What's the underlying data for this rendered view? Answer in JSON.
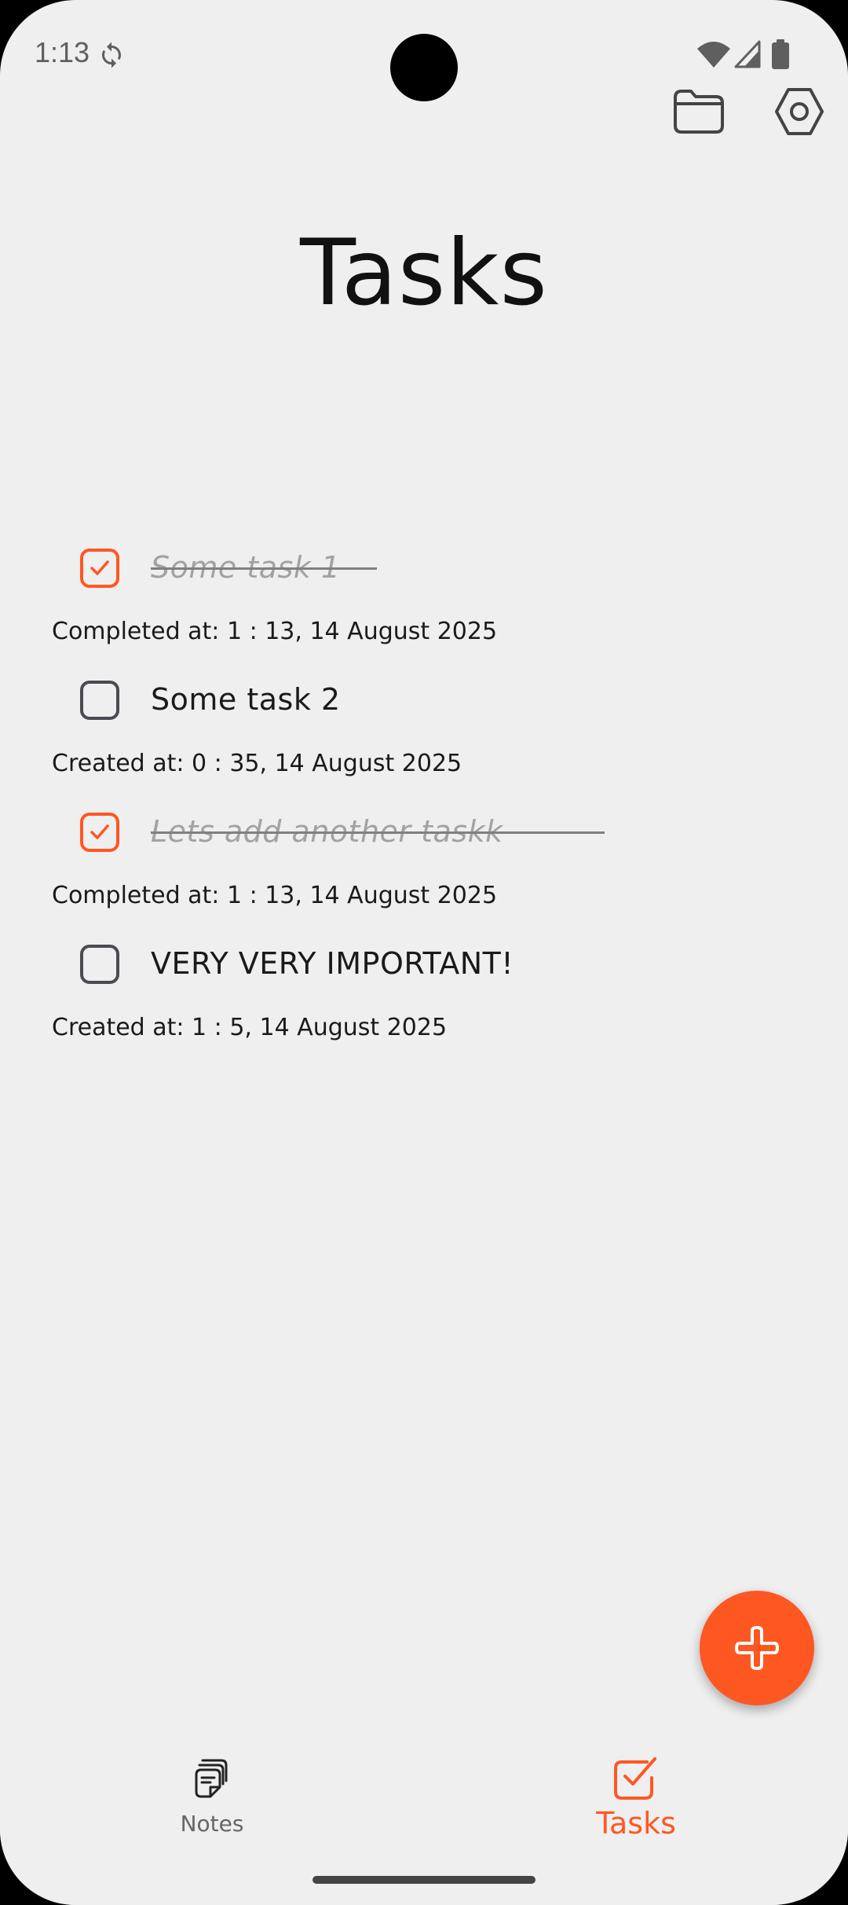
{
  "status_bar": {
    "time": "1:13"
  },
  "page": {
    "title": "Tasks"
  },
  "tasks": [
    {
      "title": "Some task 1",
      "completed": true,
      "meta": "Completed at: 1 : 13, 14 August 2025"
    },
    {
      "title": "Some task 2",
      "completed": false,
      "meta": "Created at: 0 : 35, 14 August 2025"
    },
    {
      "title": "Lets add another taskk",
      "completed": true,
      "meta": "Completed at: 1 : 13, 14 August 2025"
    },
    {
      "title": "VERY VERY IMPORTANT!",
      "completed": false,
      "meta": "Created at: 1 : 5, 14 August 2025"
    }
  ],
  "toolbar": {
    "folder_icon": "folder-icon",
    "settings_icon": "settings-icon"
  },
  "fab": {
    "icon": "plus-icon"
  },
  "bottom_nav": {
    "items": [
      {
        "label": "Notes",
        "icon": "notes-icon",
        "active": false
      },
      {
        "label": "Tasks",
        "icon": "tasks-icon",
        "active": true
      }
    ]
  },
  "colors": {
    "accent": "#ff5722",
    "background": "#efefef",
    "text": "#1a1a1a",
    "muted": "#a2a2a2"
  }
}
